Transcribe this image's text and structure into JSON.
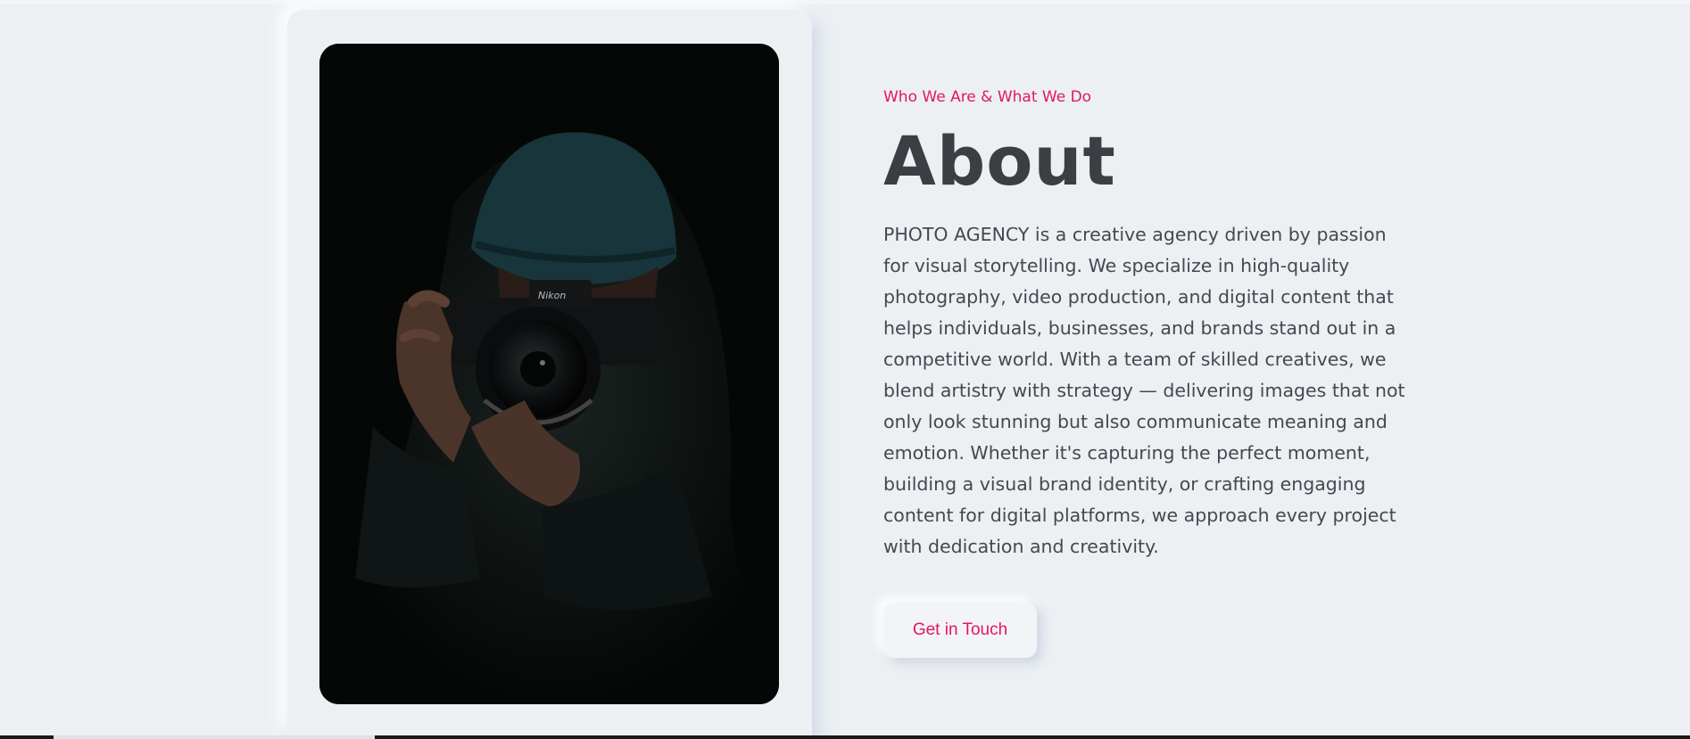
{
  "about": {
    "eyebrow": "Who We Are & What We Do",
    "title": "About",
    "description": "PHOTO AGENCY is a creative agency driven by passion for visual storytelling. We specialize in high-quality photography, video production, and digital content that helps individuals, businesses, and brands stand out in a competitive world. With a team of skilled creatives, we blend artistry with strategy — delivering images that not only look stunning but also communicate meaning and emotion. Whether it's capturing the perfect moment, building a visual brand identity, or crafting engaging content for digital platforms, we approach every project with dedication and creativity.",
    "cta_label": "Get in Touch"
  },
  "photo": {
    "camera_brand": "Nikon"
  },
  "colors": {
    "accent": "#e3175f",
    "background": "#ecf0f3",
    "heading": "#3b3e43",
    "body_text": "#454850"
  }
}
